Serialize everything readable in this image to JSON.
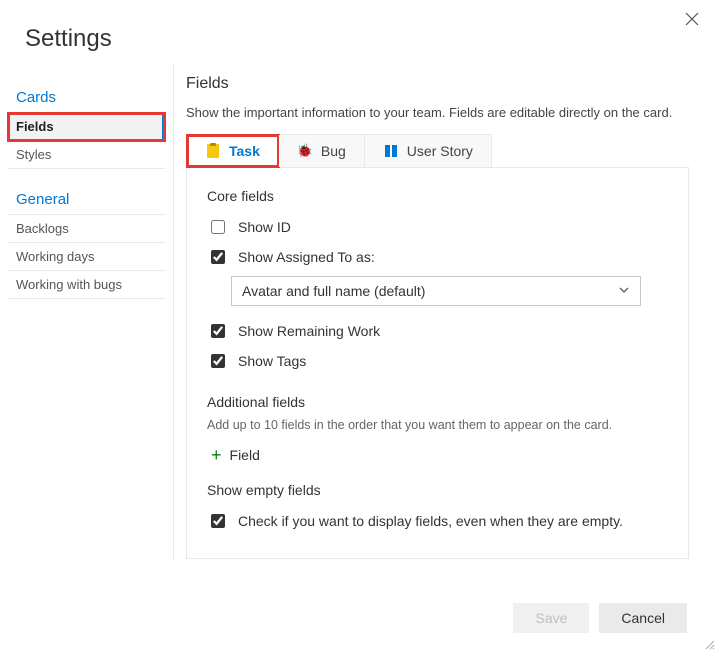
{
  "header": {
    "title": "Settings"
  },
  "sidebar": {
    "groups": [
      {
        "title": "Cards",
        "items": [
          {
            "label": "Fields",
            "selected": true,
            "highlighted": true
          },
          {
            "label": "Styles"
          }
        ]
      },
      {
        "title": "General",
        "items": [
          {
            "label": "Backlogs"
          },
          {
            "label": "Working days"
          },
          {
            "label": "Working with bugs"
          }
        ]
      }
    ]
  },
  "main": {
    "title": "Fields",
    "description": "Show the important information to your team. Fields are editable directly on the card.",
    "tabs": [
      {
        "label": "Task",
        "icon": "task-icon",
        "active": true,
        "highlighted": true
      },
      {
        "label": "Bug",
        "icon": "bug-icon"
      },
      {
        "label": "User Story",
        "icon": "story-icon"
      }
    ],
    "core": {
      "heading": "Core fields",
      "showId": {
        "label": "Show ID",
        "checked": false
      },
      "showAssigned": {
        "label": "Show Assigned To as:",
        "checked": true,
        "value": "Avatar and full name (default)"
      },
      "showRemaining": {
        "label": "Show Remaining Work",
        "checked": true
      },
      "showTags": {
        "label": "Show Tags",
        "checked": true
      }
    },
    "additional": {
      "heading": "Additional fields",
      "description": "Add up to 10 fields in the order that you want them to appear on the card.",
      "addLabel": "Field"
    },
    "empty": {
      "heading": "Show empty fields",
      "label": "Check if you want to display fields, even when they are empty.",
      "checked": true
    }
  },
  "footer": {
    "save": "Save",
    "cancel": "Cancel"
  }
}
